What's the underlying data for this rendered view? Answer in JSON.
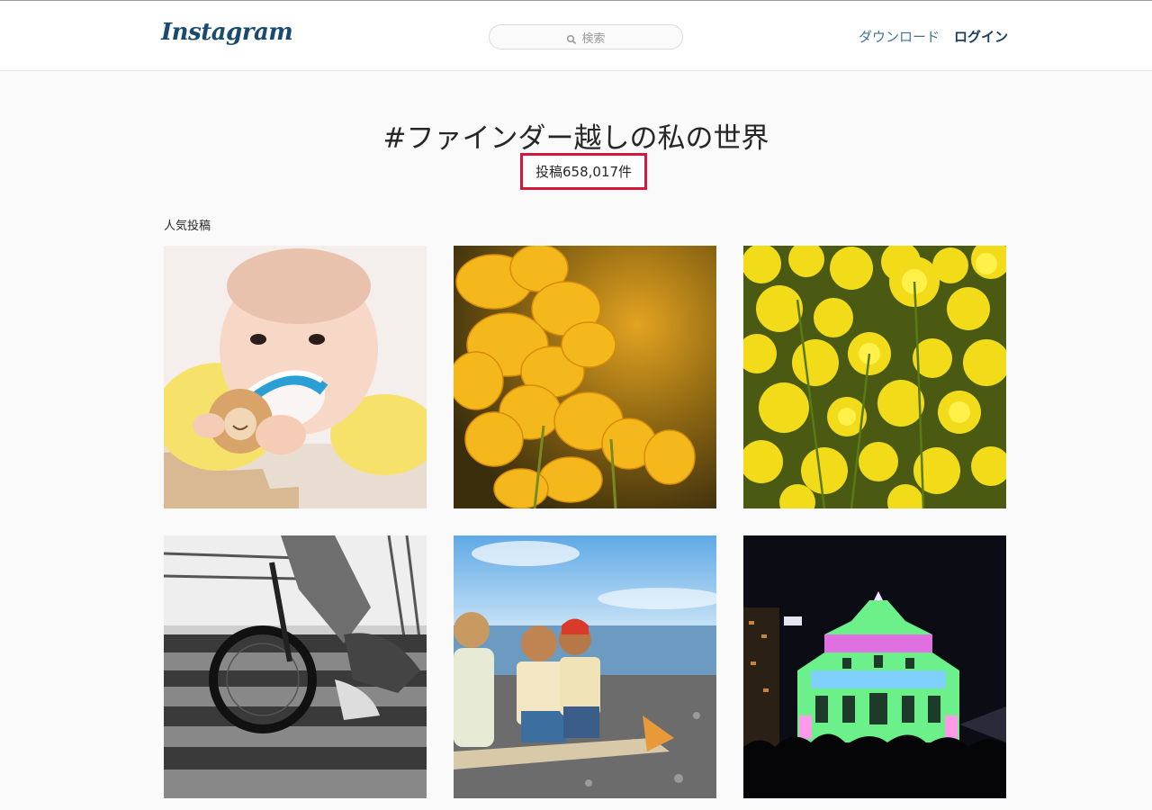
{
  "header": {
    "logo": "Instagram",
    "search_placeholder": "検索",
    "download_label": "ダウンロード",
    "login_label": "ログイン"
  },
  "hashtag": {
    "title": "#ファインダー越しの私の世界",
    "post_count": "投稿658,017件"
  },
  "section": {
    "label": "人気投稿"
  },
  "colors": {
    "highlight_border": "#d4183d",
    "link": "#3f729b",
    "logo": "#1a4a6e"
  },
  "posts": [
    {
      "subject": "baby-with-toy"
    },
    {
      "subject": "yellow-flowers-closeup"
    },
    {
      "subject": "rapeseed-field"
    },
    {
      "subject": "bicycle-stairs-monochrome"
    },
    {
      "subject": "toy-figures-beach"
    },
    {
      "subject": "illuminated-cathedral-night"
    }
  ]
}
